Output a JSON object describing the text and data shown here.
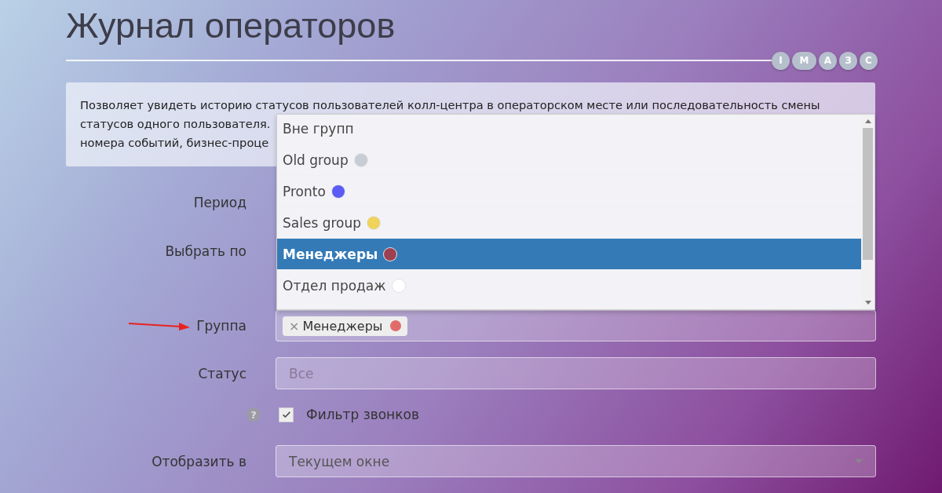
{
  "page_title": "Журнал операторов",
  "letter_buttons": [
    "I",
    "M",
    "A",
    "З",
    "С"
  ],
  "description_lines": [
    "Позволяет увидеть историю статусов пользователей колл-центра в операторском месте или последовательность смены",
    "статусов одного пользователя.",
    "номера событий, бизнес-проце"
  ],
  "form": [
    {
      "kind": "label",
      "label": "Период"
    },
    {
      "kind": "label",
      "label": "Выбрать по"
    },
    {
      "kind": "tags",
      "label": "Группа",
      "tags": [
        {
          "remove": "×",
          "text": "Менеджеры",
          "color": "#e06b6b"
        }
      ]
    },
    {
      "kind": "field",
      "label": "Статус",
      "placeholder": "Все"
    },
    {
      "kind": "checkbox",
      "help": "?",
      "label": "Фильтр звонков",
      "checked": true
    },
    {
      "kind": "select",
      "label": "Отобразить в",
      "value": "Текущем окне"
    }
  ],
  "dropdown": {
    "items": [
      {
        "text": "Вне групп",
        "selected": false
      },
      {
        "text": "Old group",
        "color": "#c8ccd4",
        "selected": false
      },
      {
        "text": "Pronto",
        "color": "#5b5bf5",
        "selected": false
      },
      {
        "text": "Sales group",
        "color": "#f0d35a",
        "selected": false
      },
      {
        "text": "Менеджеры",
        "color": "#9c4152",
        "selected": true
      },
      {
        "text": "Отдел продаж",
        "color": "#ffffff",
        "selected": false
      }
    ]
  }
}
